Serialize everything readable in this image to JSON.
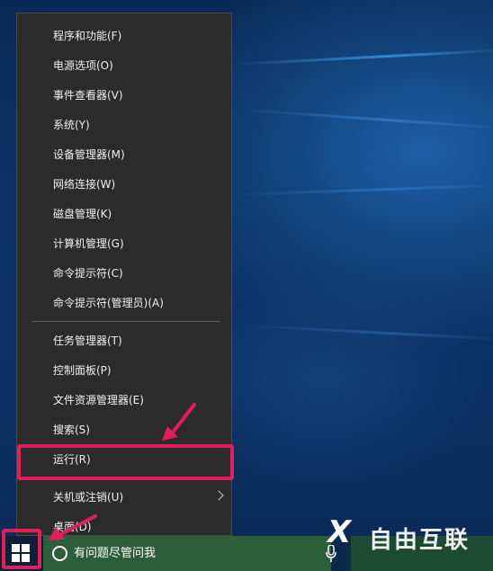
{
  "menu": {
    "items": [
      {
        "label": "程序和功能(F)"
      },
      {
        "label": "电源选项(O)"
      },
      {
        "label": "事件查看器(V)"
      },
      {
        "label": "系统(Y)"
      },
      {
        "label": "设备管理器(M)"
      },
      {
        "label": "网络连接(W)"
      },
      {
        "label": "磁盘管理(K)"
      },
      {
        "label": "计算机管理(G)"
      },
      {
        "label": "命令提示符(C)"
      },
      {
        "label": "命令提示符(管理员)(A)"
      },
      {
        "label": "任务管理器(T)"
      },
      {
        "label": "控制面板(P)"
      },
      {
        "label": "文件资源管理器(E)"
      },
      {
        "label": "搜索(S)"
      },
      {
        "label": "运行(R)"
      },
      {
        "label": "关机或注销(U)"
      },
      {
        "label": "桌面(D)"
      }
    ]
  },
  "taskbar": {
    "search_placeholder": "有问题尽管问我",
    "start_icon": "windows-logo-icon"
  },
  "watermark": "自由互联",
  "colors": {
    "highlight": "#e41e5a",
    "menu_bg": "#2b2b2b",
    "desktop": "#0b3266"
  }
}
